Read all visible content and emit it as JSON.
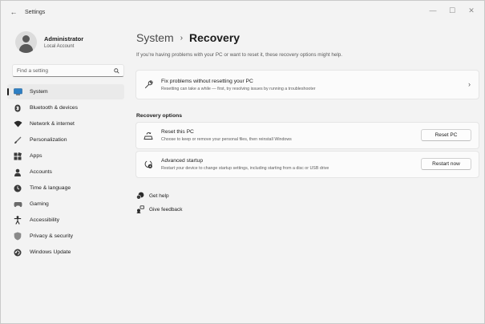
{
  "window": {
    "title": "Settings",
    "controls": {
      "minimize": "—",
      "maximize": "☐",
      "close": "✕"
    }
  },
  "profile": {
    "name": "Administrator",
    "subtitle": "Local Account"
  },
  "search": {
    "placeholder": "Find a setting",
    "icon": "search-icon"
  },
  "sidebar": {
    "items": [
      {
        "label": "System",
        "icon": "monitor-icon",
        "active": true
      },
      {
        "label": "Bluetooth & devices",
        "icon": "bluetooth-icon"
      },
      {
        "label": "Network & internet",
        "icon": "wifi-icon"
      },
      {
        "label": "Personalization",
        "icon": "brush-icon"
      },
      {
        "label": "Apps",
        "icon": "apps-icon"
      },
      {
        "label": "Accounts",
        "icon": "person-icon"
      },
      {
        "label": "Time & language",
        "icon": "globe-clock-icon"
      },
      {
        "label": "Gaming",
        "icon": "gamepad-icon"
      },
      {
        "label": "Accessibility",
        "icon": "accessibility-icon"
      },
      {
        "label": "Privacy & security",
        "icon": "shield-icon"
      },
      {
        "label": "Windows Update",
        "icon": "update-icon"
      }
    ]
  },
  "header": {
    "parent": "System",
    "separator": "›",
    "current": "Recovery"
  },
  "intro": "If you're having problems with your PC or want to reset it, these recovery options might help.",
  "fix_card": {
    "title": "Fix problems without resetting your PC",
    "subtitle": "Resetting can take a while — first, try resolving issues by running a troubleshooter",
    "chevron": "›"
  },
  "recovery_options": {
    "heading": "Recovery options",
    "reset": {
      "title": "Reset this PC",
      "subtitle": "Choose to keep or remove your personal files, then reinstall Windows",
      "button": "Reset PC"
    },
    "advanced": {
      "title": "Advanced startup",
      "subtitle": "Restart your device to change startup settings, including starting from a disc or USB drive",
      "button": "Restart now"
    }
  },
  "links": {
    "help": "Get help",
    "feedback": "Give feedback"
  },
  "colors": {
    "background": "#f3f3f3",
    "card": "#fbfbfb",
    "active_nav": "#eaeaea",
    "accent_indicator": "#1c1c1c"
  }
}
